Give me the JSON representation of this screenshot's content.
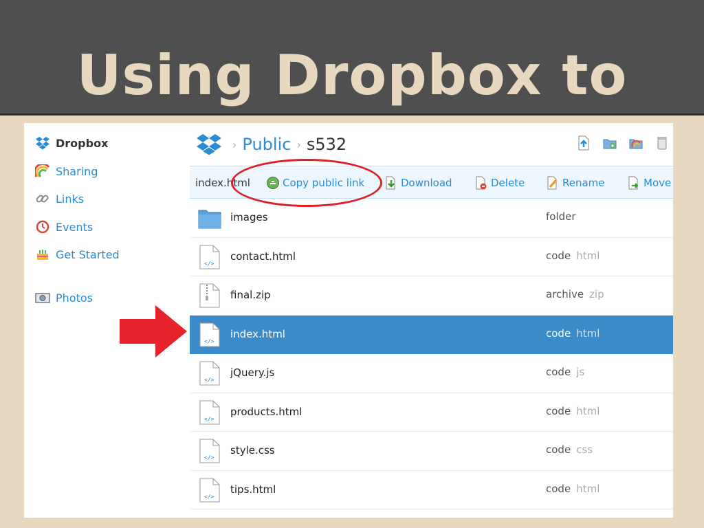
{
  "slide": {
    "title": "Using Dropbox to Host"
  },
  "sidebar": {
    "items": [
      {
        "label": "Dropbox",
        "icon": "dropbox-logo-icon"
      },
      {
        "label": "Sharing",
        "icon": "rainbow-icon"
      },
      {
        "label": "Links",
        "icon": "link-icon"
      },
      {
        "label": "Events",
        "icon": "clock-icon"
      },
      {
        "label": "Get Started",
        "icon": "cake-icon"
      },
      {
        "label": "Photos",
        "icon": "camera-icon"
      }
    ]
  },
  "breadcrumb": {
    "parent": "Public",
    "current": "s532",
    "separator": "›"
  },
  "toolbar": {
    "selected_file": "index.html",
    "copy_link": "Copy public link",
    "download": "Download",
    "delete": "Delete",
    "rename": "Rename",
    "move": "Move"
  },
  "files": [
    {
      "name": "images",
      "kind": "folder",
      "ext": "",
      "icon": "folder-icon"
    },
    {
      "name": "contact.html",
      "kind": "code",
      "ext": "html",
      "icon": "code-file-icon"
    },
    {
      "name": "final.zip",
      "kind": "archive",
      "ext": "zip",
      "icon": "zip-file-icon"
    },
    {
      "name": "index.html",
      "kind": "code",
      "ext": "html",
      "icon": "code-file-icon",
      "selected": true
    },
    {
      "name": "jQuery.js",
      "kind": "code",
      "ext": "js",
      "icon": "code-file-icon"
    },
    {
      "name": "products.html",
      "kind": "code",
      "ext": "html",
      "icon": "code-file-icon"
    },
    {
      "name": "style.css",
      "kind": "code",
      "ext": "css",
      "icon": "code-file-icon"
    },
    {
      "name": "tips.html",
      "kind": "code",
      "ext": "html",
      "icon": "code-file-icon"
    }
  ],
  "colors": {
    "accent": "#2a8bd6",
    "selected_row": "#3b8bc9",
    "annotation_red": "#dd2027",
    "slide_background": "#e8d8bf",
    "title_bar": "#4f4f4f"
  }
}
